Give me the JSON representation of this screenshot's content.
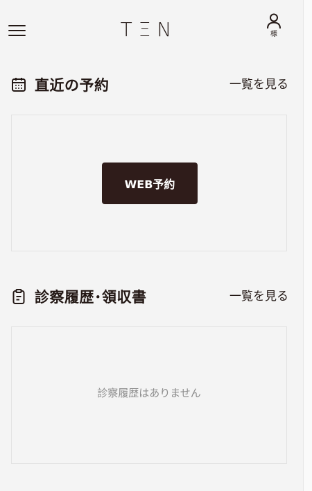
{
  "header": {
    "logo": "TΞN",
    "account_label": "様"
  },
  "reservation": {
    "title": "直近の予約",
    "see_all": "一覧を見る",
    "button_label": "WEB予約"
  },
  "history": {
    "title": "診察履歴･領収書",
    "see_all": "一覧を見る",
    "empty_text": "診察履歴はありません"
  },
  "colors": {
    "background": "#f4f4f4",
    "primary": "#2f1c1a",
    "text": "#231815",
    "muted_text": "#8c8c8c",
    "border": "#e2e2e2"
  },
  "icons": [
    "menu-icon",
    "user-icon",
    "calendar-icon",
    "clipboard-icon"
  ]
}
